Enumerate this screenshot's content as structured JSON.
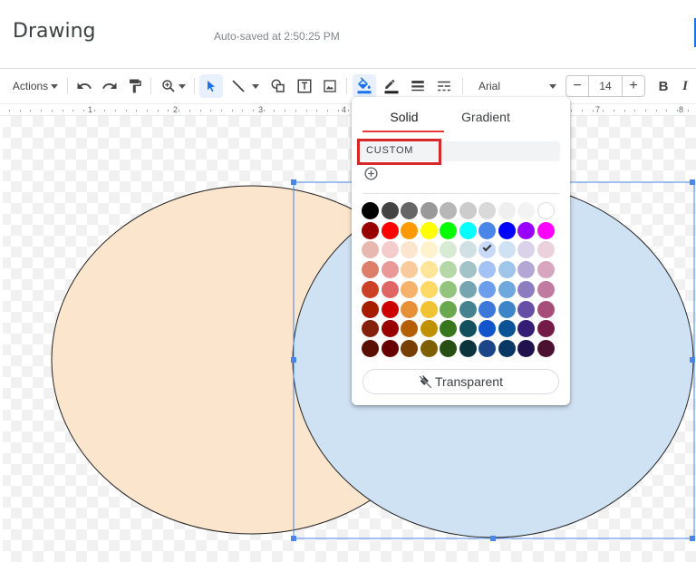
{
  "header": {
    "title": "Drawing",
    "autosave": "Auto-saved at 2:50:25 PM"
  },
  "toolbar": {
    "actions_label": "Actions",
    "font": "Arial",
    "font_size": "14",
    "decrease_label": "−",
    "increase_label": "+",
    "bold_label": "B",
    "italic_label": "I"
  },
  "ruler": {
    "numbers": [
      "1",
      "2",
      "3",
      "4",
      "7",
      "8"
    ]
  },
  "popup": {
    "tabs": [
      {
        "label": "Solid",
        "selected": true
      },
      {
        "label": "Gradient",
        "selected": false
      }
    ],
    "custom_label": "CUSTOM",
    "transparent_label": "Transparent",
    "selected_swatch": "#c9daf8",
    "swatch_rows": [
      [
        "#000000",
        "#434343",
        "#666666",
        "#999999",
        "#b7b7b7",
        "#cccccc",
        "#d9d9d9",
        "#efefef",
        "#f3f3f3",
        "#ffffff"
      ],
      [
        "#980000",
        "#ff0000",
        "#ff9900",
        "#ffff00",
        "#00ff00",
        "#00ffff",
        "#4a86e8",
        "#0000ff",
        "#9900ff",
        "#ff00ff"
      ],
      [
        "#e6b8af",
        "#f4cccc",
        "#fce5cd",
        "#fff2cc",
        "#d9ead3",
        "#d0e0e3",
        "#c9daf8",
        "#cfe2f3",
        "#d9d2e9",
        "#ead1dc"
      ],
      [
        "#dd7e6b",
        "#ea9999",
        "#f9cb9c",
        "#ffe599",
        "#b6d7a8",
        "#a2c4c9",
        "#a4c2f4",
        "#9fc5e8",
        "#b4a7d6",
        "#d5a6bd"
      ],
      [
        "#cc4125",
        "#e06666",
        "#f6b26b",
        "#ffd966",
        "#93c47d",
        "#76a5af",
        "#6d9eeb",
        "#6fa8dc",
        "#8e7cc3",
        "#c27ba0"
      ],
      [
        "#a61c00",
        "#cc0000",
        "#e69138",
        "#f1c232",
        "#6aa84f",
        "#45818e",
        "#3c78d8",
        "#3d85c6",
        "#674ea7",
        "#a64d79"
      ],
      [
        "#85200c",
        "#990000",
        "#b45f06",
        "#bf9000",
        "#38761d",
        "#134f5c",
        "#1155cc",
        "#0b5394",
        "#351c75",
        "#741b47"
      ],
      [
        "#5b0f00",
        "#660000",
        "#783f04",
        "#7f6000",
        "#274e13",
        "#0c343d",
        "#1c4587",
        "#073763",
        "#20124d",
        "#4c1130"
      ]
    ]
  },
  "shapes": {
    "left_circle_fill": "#fce5cd",
    "right_circle_fill": "#cfe2f3",
    "selection_color": "#4a86e8"
  },
  "colors": {
    "highlight_border": "#d62828",
    "tab_underline": "#e53935"
  }
}
